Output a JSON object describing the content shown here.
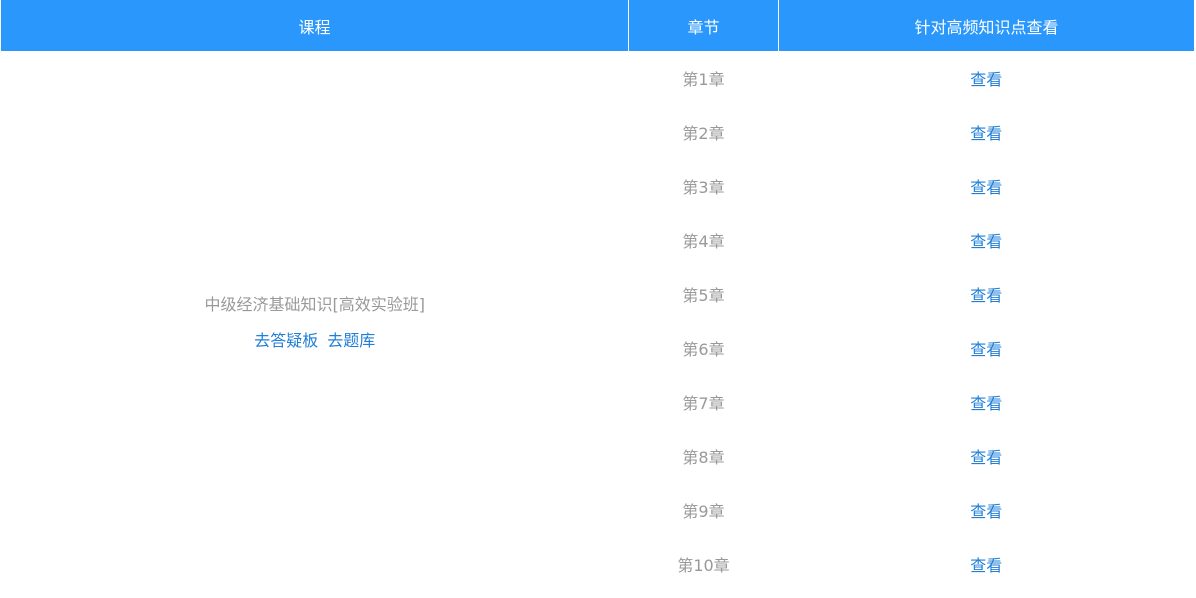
{
  "header": {
    "course": "课程",
    "chapter": "章节",
    "view": "针对高频知识点查看"
  },
  "course": {
    "name": "中级经济基础知识[高效实验班]",
    "link_qa": "去答疑板",
    "link_bank": "去题库"
  },
  "rows": [
    {
      "chapter": "第1章",
      "action": "查看"
    },
    {
      "chapter": "第2章",
      "action": "查看"
    },
    {
      "chapter": "第3章",
      "action": "查看"
    },
    {
      "chapter": "第4章",
      "action": "查看"
    },
    {
      "chapter": "第5章",
      "action": "查看"
    },
    {
      "chapter": "第6章",
      "action": "查看"
    },
    {
      "chapter": "第7章",
      "action": "查看"
    },
    {
      "chapter": "第8章",
      "action": "查看"
    },
    {
      "chapter": "第9章",
      "action": "查看"
    },
    {
      "chapter": "第10章",
      "action": "查看"
    }
  ],
  "colors": {
    "header_bg": "#2a97fd",
    "link": "#1f7fd6",
    "muted_text": "#999999"
  }
}
